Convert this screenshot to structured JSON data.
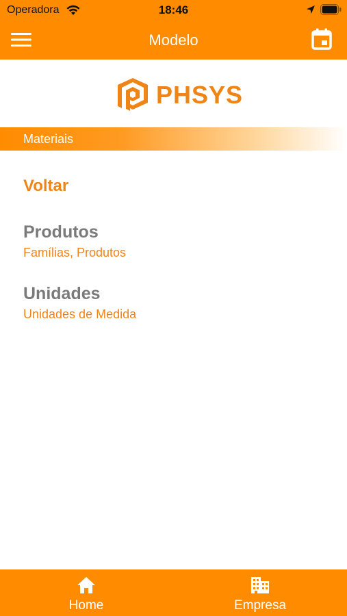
{
  "status_bar": {
    "carrier": "Operadora",
    "time": "18:46"
  },
  "nav": {
    "title": "Modelo"
  },
  "logo": {
    "text": "PHSYS"
  },
  "section": {
    "label": "Materiais"
  },
  "back": {
    "label": "Voltar"
  },
  "menu_items": [
    {
      "title": "Produtos",
      "subtitle": "Famílias, Produtos"
    },
    {
      "title": "Unidades",
      "subtitle": "Unidades de Medida"
    }
  ],
  "tabs": [
    {
      "label": "Home",
      "icon": "home-icon"
    },
    {
      "label": "Empresa",
      "icon": "building-icon"
    }
  ],
  "colors": {
    "accent": "#ff8c00",
    "logo_orange": "#ef8417",
    "item_title_gray": "#7a7a7a"
  }
}
